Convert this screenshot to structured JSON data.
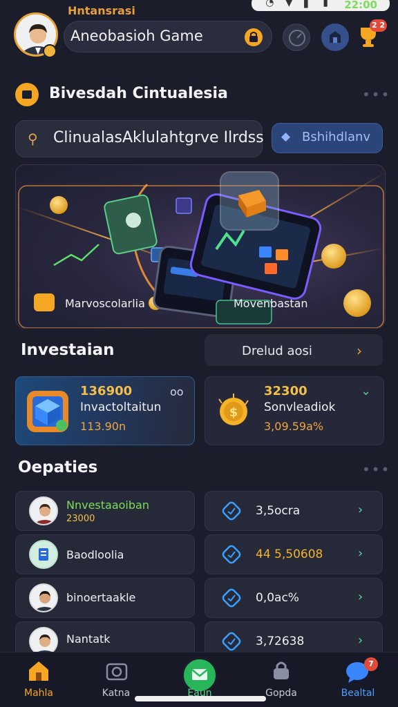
{
  "status_bar": {
    "time": "22:00"
  },
  "header": {
    "kicker": "Hntansrasi",
    "title": "Aneobasioh Game",
    "notification_count": "2 2"
  },
  "section": {
    "title": "Bivesdah Cintualesia",
    "search_text": "ClinualasAklulahtgrve Ilrdss",
    "search_button": "Bshihdlanv"
  },
  "hero": {
    "caption_left": "Marvoscolarlia",
    "caption_right": "Movenbastan"
  },
  "investment": {
    "title": "Investaian",
    "link_label": "Drelud aosi",
    "cards": [
      {
        "value": "136900",
        "label": "Invactoltaitun",
        "sub": "113.90n",
        "extra": "oo"
      },
      {
        "value": "32300",
        "label": "Sonvleadiok",
        "sub": "3,09.59a%"
      }
    ]
  },
  "deposits": {
    "title": "Oepaties",
    "left": [
      {
        "name": "Nnvestaaoiban",
        "sub": "23000"
      },
      {
        "name": "Baodloolia",
        "sub": ""
      },
      {
        "name": "binoertaakle",
        "sub": ""
      },
      {
        "name": "Nantatk",
        "sub": ""
      }
    ],
    "right": [
      {
        "value": "3,5ocra"
      },
      {
        "value": "44 5,50608"
      },
      {
        "value": "0,0ac%"
      },
      {
        "value": "3,72638"
      }
    ]
  },
  "nav": {
    "items": [
      "Mahla",
      "Katna",
      "Eaun",
      "Gopda",
      "Bealtal"
    ],
    "badge": "7"
  },
  "colors": {
    "accent_orange": "#f5a623",
    "accent_green": "#29b65a",
    "accent_blue": "#3b5a98",
    "background": "#1b1d2a"
  }
}
